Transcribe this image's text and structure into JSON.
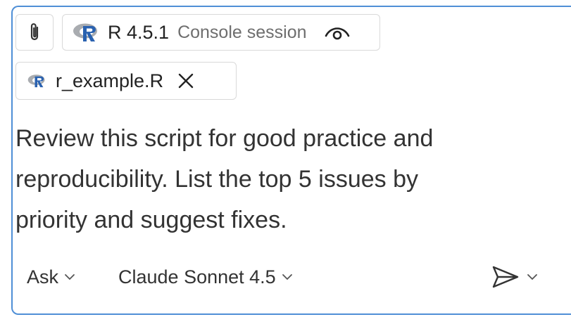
{
  "context_chips": {
    "attach": {
      "icon": "paperclip-icon"
    },
    "session": {
      "icon": "r-logo-icon",
      "version": "R 4.5.1",
      "subtitle": "Console session",
      "toggle_icon": "eye-icon"
    },
    "file": {
      "icon": "r-logo-icon",
      "name": "r_example.R",
      "remove_icon": "close-icon"
    }
  },
  "prompt": {
    "lines": [
      "Review this script for good practice and",
      "reproducibility. List the top 5 issues by",
      "priority and suggest fixes."
    ]
  },
  "footer": {
    "mode": "Ask",
    "model": "Claude Sonnet 4.5",
    "send_icon": "send-icon",
    "send_menu_icon": "chevron-down-icon"
  },
  "colors": {
    "border_focus": "#4f8fd6",
    "r_logo_blue": "#2a62b0",
    "r_logo_grey": "#a9acb0"
  }
}
